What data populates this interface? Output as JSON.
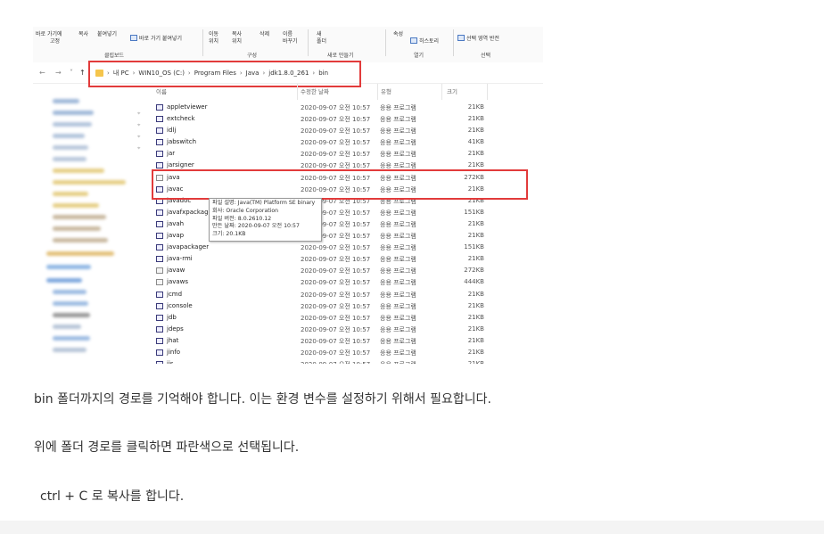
{
  "ribbon": {
    "buttons": [
      "바로 가기에",
      "고정",
      "복사",
      "붙여넣기",
      "바로 가기 붙여넣기",
      "이동",
      "위치",
      "복사",
      "위치",
      "삭제",
      "이름",
      "바꾸기",
      "새",
      "폴더",
      "속성",
      "히스토리",
      "선택 영역 반전"
    ],
    "groups": [
      "클립보드",
      "구성",
      "새로 만들기",
      "열기",
      "선택"
    ]
  },
  "address": {
    "nav": [
      "←",
      "→",
      "˅",
      "↑"
    ],
    "crumbs": [
      "내 PC",
      "WIN10_OS (C:)",
      "Program Files",
      "Java",
      "jdk1.8.0_261",
      "bin"
    ],
    "separator": "›"
  },
  "columns": {
    "name": "이름",
    "date": "수정한 날짜",
    "type": "유형",
    "size": "크기"
  },
  "files": [
    {
      "name": "appletviewer",
      "date": "2020-09-07 오전 10:57",
      "type": "응용 프로그램",
      "size": "21KB"
    },
    {
      "name": "extcheck",
      "date": "2020-09-07 오전 10:57",
      "type": "응용 프로그램",
      "size": "21KB"
    },
    {
      "name": "idlj",
      "date": "2020-09-07 오전 10:57",
      "type": "응용 프로그램",
      "size": "21KB"
    },
    {
      "name": "jabswitch",
      "date": "2020-09-07 오전 10:57",
      "type": "응용 프로그램",
      "size": "41KB"
    },
    {
      "name": "jar",
      "date": "2020-09-07 오전 10:57",
      "type": "응용 프로그램",
      "size": "21KB"
    },
    {
      "name": "jarsigner",
      "date": "2020-09-07 오전 10:57",
      "type": "응용 프로그램",
      "size": "21KB"
    },
    {
      "name": "java",
      "date": "2020-09-07 오전 10:57",
      "type": "응용 프로그램",
      "size": "272KB"
    },
    {
      "name": "javac",
      "date": "2020-09-07 오전 10:57",
      "type": "응용 프로그램",
      "size": "21KB"
    },
    {
      "name": "javadoc",
      "date": "2020-09-07 오전 10:57",
      "type": "응용 프로그램",
      "size": "21KB"
    },
    {
      "name": "javafxpackager",
      "date": "2020-09-07 오전 10:57",
      "type": "응용 프로그램",
      "size": "151KB"
    },
    {
      "name": "javah",
      "date": "2020-09-07 오전 10:57",
      "type": "응용 프로그램",
      "size": "21KB"
    },
    {
      "name": "javap",
      "date": "2020-09-07 오전 10:57",
      "type": "응용 프로그램",
      "size": "21KB"
    },
    {
      "name": "javapackager",
      "date": "2020-09-07 오전 10:57",
      "type": "응용 프로그램",
      "size": "151KB"
    },
    {
      "name": "java-rmi",
      "date": "2020-09-07 오전 10:57",
      "type": "응용 프로그램",
      "size": "21KB"
    },
    {
      "name": "javaw",
      "date": "2020-09-07 오전 10:57",
      "type": "응용 프로그램",
      "size": "272KB"
    },
    {
      "name": "javaws",
      "date": "2020-09-07 오전 10:57",
      "type": "응용 프로그램",
      "size": "444KB"
    },
    {
      "name": "jcmd",
      "date": "2020-09-07 오전 10:57",
      "type": "응용 프로그램",
      "size": "21KB"
    },
    {
      "name": "jconsole",
      "date": "2020-09-07 오전 10:57",
      "type": "응용 프로그램",
      "size": "21KB"
    },
    {
      "name": "jdb",
      "date": "2020-09-07 오전 10:57",
      "type": "응용 프로그램",
      "size": "21KB"
    },
    {
      "name": "jdeps",
      "date": "2020-09-07 오전 10:57",
      "type": "응용 프로그램",
      "size": "21KB"
    },
    {
      "name": "jhat",
      "date": "2020-09-07 오전 10:57",
      "type": "응용 프로그램",
      "size": "21KB"
    },
    {
      "name": "jinfo",
      "date": "2020-09-07 오전 10:57",
      "type": "응용 프로그램",
      "size": "21KB"
    },
    {
      "name": "jjs",
      "date": "2020-09-07 오전 10:57",
      "type": "응용 프로그램",
      "size": "21KB"
    }
  ],
  "tooltip": [
    "파일 설명: Java(TM) Platform SE binary",
    "회사: Oracle Corporation",
    "파일 버전: 8.0.2610.12",
    "만든 날짜: 2020-09-07 오전 10:57",
    "크기: 20.1KB"
  ],
  "paragraphs": [
    "bin 폴더까지의 경로를 기억해야 합니다. 이는 환경 변수를 설정하기 위해서 필요합니다.",
    "위에 폴더 경로를 클릭하면 파란색으로 선택됩니다.",
    "ctrl + C  로 복사를 합니다."
  ],
  "colors": {
    "highlight_box": "#e23b3b",
    "selection": "#e5f1fb",
    "folder": "#f5c54c"
  }
}
